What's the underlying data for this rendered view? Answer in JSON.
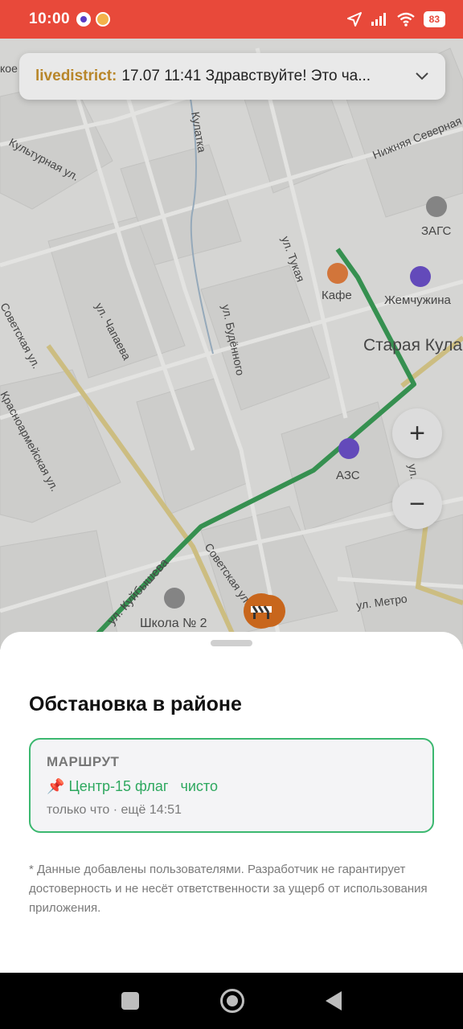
{
  "status_bar": {
    "time": "10:00",
    "battery": "83",
    "colors": {
      "background": "#e8493a"
    }
  },
  "banner": {
    "source": "livedistrict:",
    "message": "17.07 11:41 Здравствуйте! Это ча...",
    "expand_icon": "chevron-down-icon"
  },
  "map": {
    "labels": {
      "kultyrnaya": "Культурная ул.",
      "kulatka": "Кулатка",
      "nizhnyaya_severnaya": "Нижняя Северная ул.",
      "zags": "ЗАГС",
      "tukaya": "ул. Тукая",
      "kafe": "Кафе",
      "zhemchuzhina": "Жемчужина",
      "staraya": "Старая Кула",
      "sovetskaya1": "Советская ул.",
      "chapaeva": "ул. Чапаева",
      "budennogo": "ул. Будённого",
      "krasnoarmeyskaya": "Красноармейская ул.",
      "azs": "АЗС",
      "kuybysheva": "ул. Куйбышева",
      "sovetskaya2": "Советская ул.",
      "shkola": "Школа № 2",
      "metro": "ул. Метро",
      "ul": "ул.",
      "koe": "кое"
    },
    "zoom_in_label": "+",
    "zoom_out_label": "−",
    "colors": {
      "route": "#3a9a55",
      "road_yellow": "#d9c98a",
      "background": "#e3e3e1"
    }
  },
  "sheet": {
    "title": "Обстановка в районе",
    "route_card": {
      "label": "МАРШРУТ",
      "pin_icon": "📌",
      "route_name": "Центр-15 флаг",
      "status": "чисто",
      "meta": "только что · ещё 14:51"
    },
    "disclaimer": "* Данные добавлены пользователями. Разработчик не гарантирует достоверность и не несёт ответственности за ущерб от использования приложения."
  }
}
